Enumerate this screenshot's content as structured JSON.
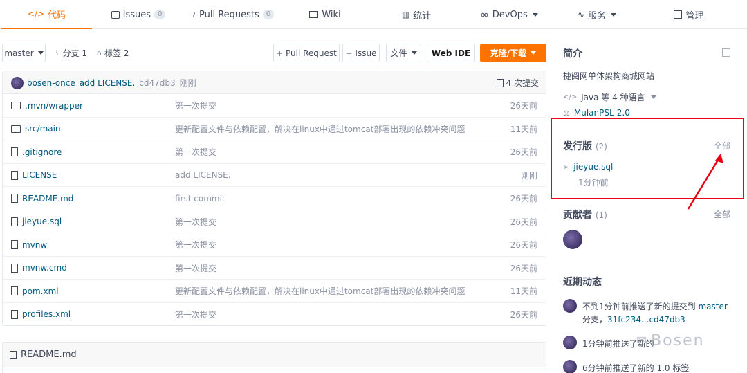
{
  "nav": {
    "code": "代码",
    "issues": "Issues",
    "issues_count": "0",
    "pull_requests": "Pull Requests",
    "pull_requests_count": "0",
    "wiki": "Wiki",
    "stats": "统计",
    "devops": "DevOps",
    "services": "服务",
    "manage": "管理"
  },
  "toolbar": {
    "branch": "master",
    "branches": "分支 1",
    "tags": "标签 2",
    "new_pr": "+ Pull Request",
    "new_issue": "+ Issue",
    "files": "文件",
    "web_ide": "Web IDE",
    "clone": "克隆/下载"
  },
  "commit": {
    "author": "bosen-once",
    "message": "add LICENSE.",
    "sha": "cd47db3",
    "time": "刚刚",
    "count": "4 次提交"
  },
  "files": [
    {
      "name": ".mvn/wrapper",
      "type": "folder",
      "message": "第一次提交",
      "time": "26天前"
    },
    {
      "name": "src/main",
      "type": "folder",
      "message": "更新配置文件与依赖配置，解决在linux中通过tomcat部署出现的依赖冲突问题",
      "time": "11天前"
    },
    {
      "name": ".gitignore",
      "type": "file",
      "message": "第一次提交",
      "time": "26天前"
    },
    {
      "name": "LICENSE",
      "type": "file",
      "message": "add LICENSE.",
      "time": "刚刚"
    },
    {
      "name": "README.md",
      "type": "file",
      "message": "first commit",
      "time": "26天前"
    },
    {
      "name": "jieyue.sql",
      "type": "file",
      "message": "第一次提交",
      "time": "26天前"
    },
    {
      "name": "mvnw",
      "type": "file",
      "message": "第一次提交",
      "time": "26天前"
    },
    {
      "name": "mvnw.cmd",
      "type": "file",
      "message": "第一次提交",
      "time": "26天前"
    },
    {
      "name": "pom.xml",
      "type": "file",
      "message": "更新配置文件与依赖配置，解决在linux中通过tomcat部署出现的依赖冲突问题",
      "time": "11天前"
    },
    {
      "name": "profiles.xml",
      "type": "file",
      "message": "第一次提交",
      "time": "26天前"
    }
  ],
  "readme": {
    "title": "README.md"
  },
  "sidebar": {
    "intro_title": "简介",
    "description": "捷阅网单体架构商城网站",
    "language": "Java 等 4 种语言",
    "license": "MulanPSL-2.0",
    "releases_title": "发行版",
    "releases_count": "(2)",
    "releases_all": "全部",
    "release_name": "jieyue.sql",
    "release_time": "1分钟前",
    "contributors_title": "贡献者",
    "contributors_count": "(1)",
    "contributors_all": "全部",
    "activity_title": "近期动态",
    "activity_1a": "不到1分钟前推送了新的提交到 ",
    "activity_1b": "master",
    "activity_1c": "分支，",
    "activity_1d": "31fc234...cd47db3",
    "activity_2": "1分钟前推送了新的",
    "activity_3": "6分钟前推送了新的 1.0 标签",
    "watermark": "Bosen"
  },
  "colors": {
    "accent": "#fe7300",
    "link": "#005980",
    "highlight": "#e60012"
  }
}
